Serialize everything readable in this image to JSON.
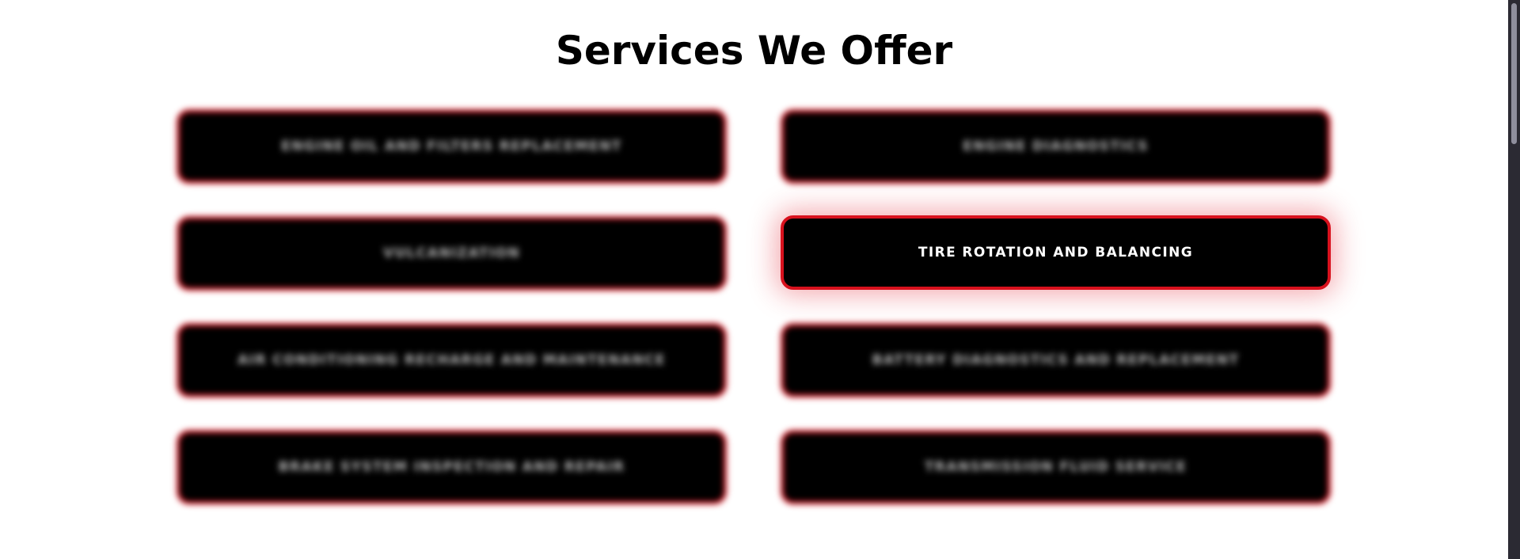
{
  "section": {
    "title": "Services We Offer"
  },
  "services": [
    {
      "label": "ENGINE OIL AND FILTERS REPLACEMENT"
    },
    {
      "label": "ENGINE DIAGNOSTICS"
    },
    {
      "label": "VULCANIZATION"
    },
    {
      "label": "TIRE ROTATION AND BALANCING"
    },
    {
      "label": "AIR CONDITIONING RECHARGE AND MAINTENANCE"
    },
    {
      "label": "BATTERY DIAGNOSTICS AND REPLACEMENT"
    },
    {
      "label": "BRAKE SYSTEM INSPECTION AND REPAIR"
    },
    {
      "label": "TRANSMISSION FLUID SERVICE"
    }
  ],
  "active_service": "TIRE ROTATION AND BALANCING",
  "colors": {
    "accent": "#d8111d",
    "card_background": "#000000",
    "page_background": "#ffffff",
    "scrollbar_track": "#2b2a33",
    "scrollbar_thumb": "#8f8f9d"
  }
}
